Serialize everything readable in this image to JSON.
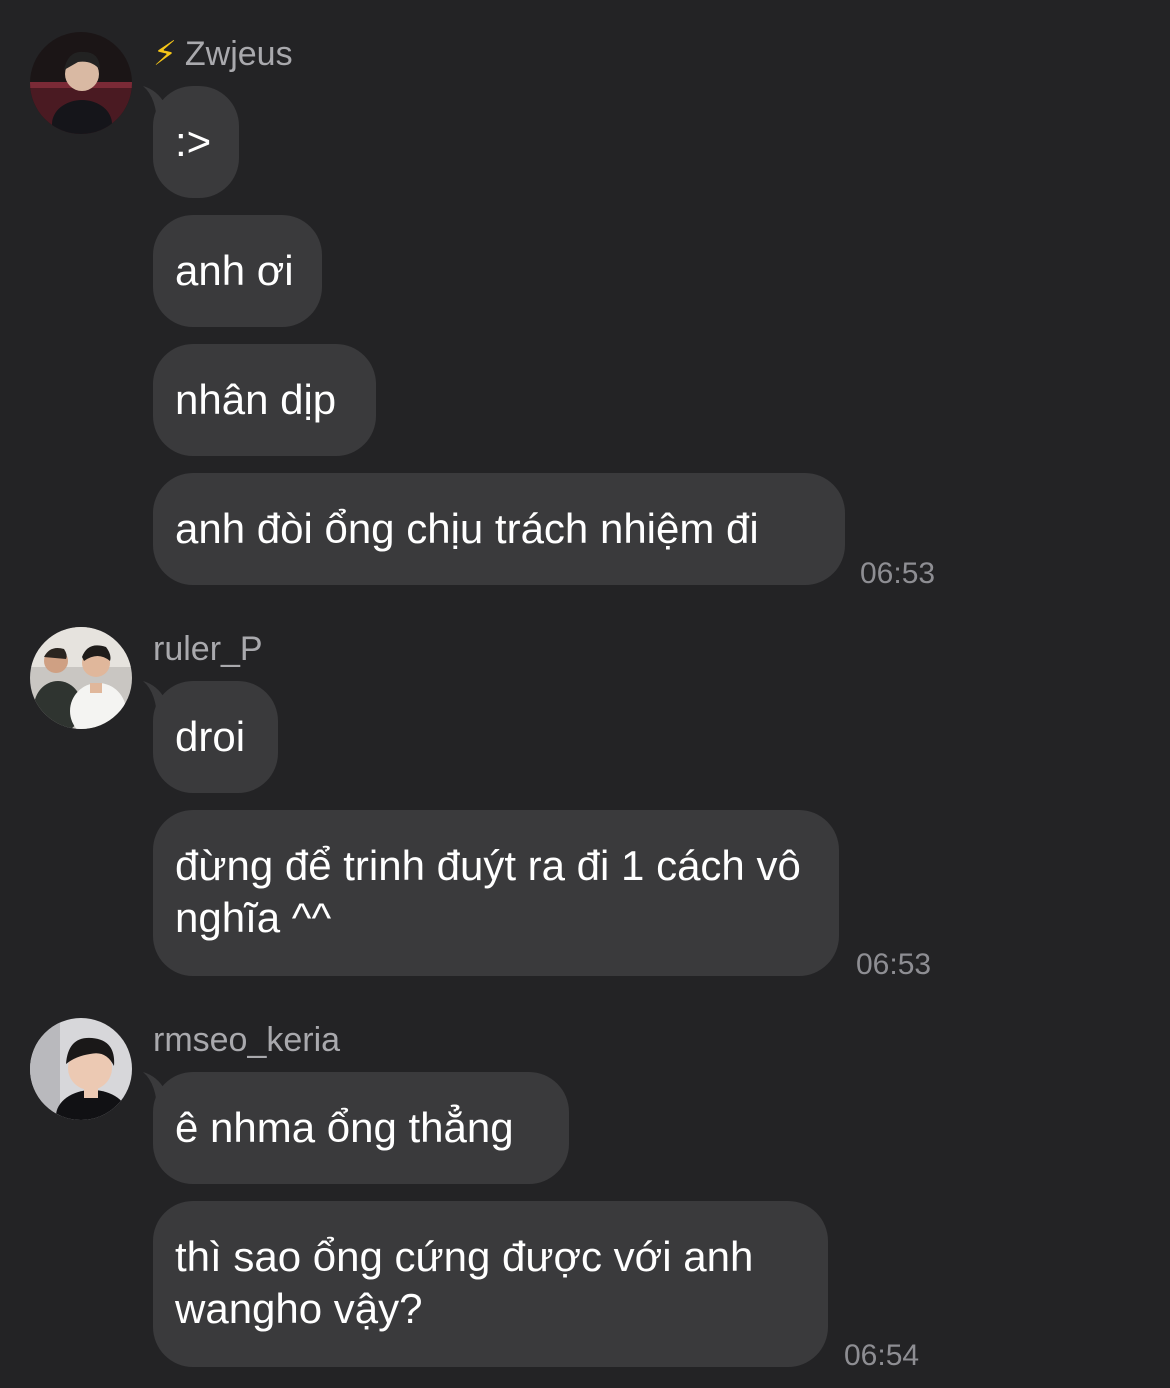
{
  "messages_groups": [
    {
      "sender": "Zwjeus",
      "sender_prefix_icon": "lightning-bolt-icon",
      "sender_prefix_glyph": "⚡",
      "avatar_icon": "avatar-zwjeus",
      "messages": [
        ":>",
        "anh ơi",
        "nhân dịp",
        "anh đòi ổng chịu trách nhiệm đi"
      ],
      "time": "06:53"
    },
    {
      "sender": "ruler_P",
      "avatar_icon": "avatar-ruler",
      "messages": [
        "droi",
        "đừng để trinh đuýt ra đi 1 cách vô nghĩa ^^"
      ],
      "time": "06:53"
    },
    {
      "sender": "rmseo_keria",
      "avatar_icon": "avatar-keria",
      "messages": [
        "ê nhma ổng thẳng",
        "thì sao ổng cứng được với anh wangho vậy?"
      ],
      "time": "06:54"
    }
  ],
  "colors": {
    "background": "#232325",
    "bubble": "#3a3a3c",
    "sender_name": "#a9a9ad",
    "timestamp": "#8e8e93",
    "lightning": "#f5c518"
  }
}
